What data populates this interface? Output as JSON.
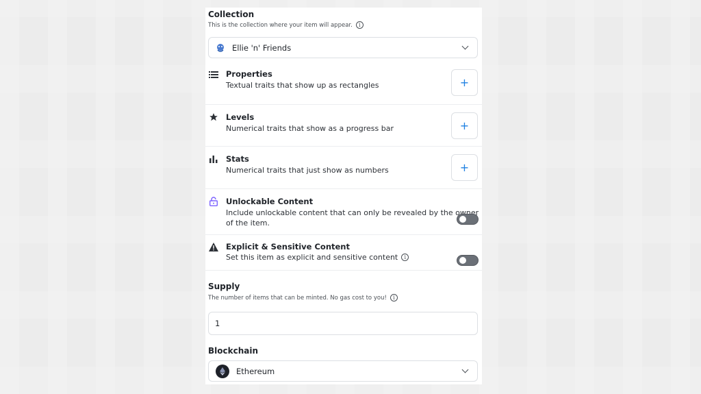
{
  "collection": {
    "title": "Collection",
    "subtitle": "This is the collection where your item will appear.",
    "selected": "Ellie 'n' Friends",
    "icon": "collection-avatar-icon"
  },
  "traits": [
    {
      "id": "properties",
      "icon": "list-icon",
      "title": "Properties",
      "desc": "Textual traits that show up as rectangles",
      "action": "+"
    },
    {
      "id": "levels",
      "icon": "star-icon",
      "title": "Levels",
      "desc": "Numerical traits that show as a progress bar",
      "action": "+"
    },
    {
      "id": "stats",
      "icon": "bar-chart-icon",
      "title": "Stats",
      "desc": "Numerical traits that just show as numbers",
      "action": "+"
    }
  ],
  "unlockable": {
    "icon": "lock-icon",
    "title": "Unlockable Content",
    "desc_line1": "Include unlockable content that can only be revealed by the owner",
    "desc_line2": "of the item.",
    "enabled": false
  },
  "explicit": {
    "icon": "warning-icon",
    "title": "Explicit & Sensitive Content",
    "desc": "Set this item as explicit and sensitive content",
    "enabled": false
  },
  "supply": {
    "title": "Supply",
    "subtitle": "The number of items that can be minted. No gas cost to you!",
    "value": "1"
  },
  "blockchain": {
    "title": "Blockchain",
    "selected": "Ethereum",
    "icon": "ethereum-icon"
  },
  "colors": {
    "accent": "#2081e2",
    "unlock_icon": "#7b61ff",
    "toggle_off": "#6b7077"
  }
}
